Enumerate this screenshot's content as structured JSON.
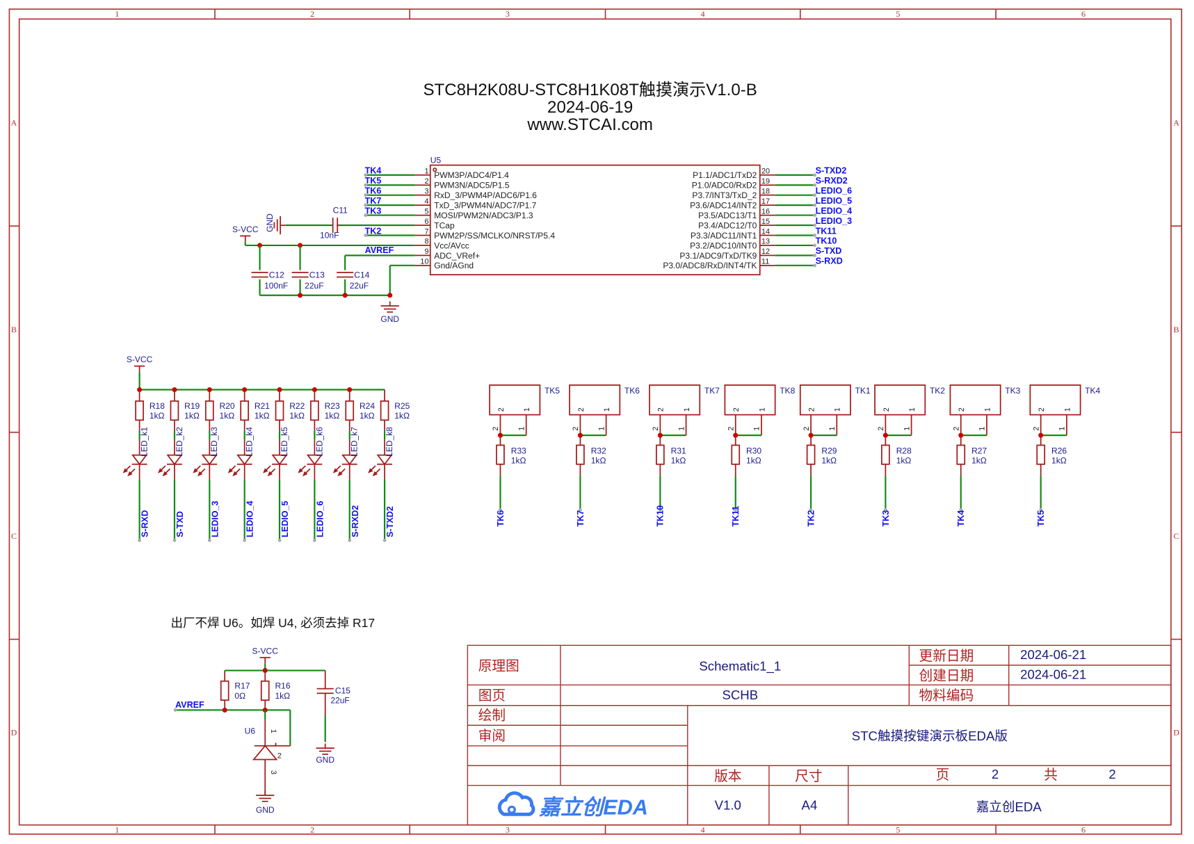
{
  "title": {
    "line1": "STC8H2K08U-STC8H1K08T触摸演示V1.0-B",
    "line2": "2024-06-19",
    "line3": "www.STCAI.com"
  },
  "border": {
    "columns": [
      "1",
      "2",
      "3",
      "4",
      "5",
      "6"
    ],
    "rows": [
      "A",
      "B",
      "C",
      "D"
    ]
  },
  "colors": {
    "wire": "#138a13",
    "component": "#a51c1c",
    "junction": "#cc0000",
    "net_label": "#1010ee",
    "designator": "#1c1c8c",
    "frame": "#b03030"
  },
  "u5": {
    "designator": "U5",
    "left_pins": [
      {
        "num": "1",
        "name": "PWM3P/ADC4/P1.4",
        "net": "TK4"
      },
      {
        "num": "2",
        "name": "PWM3N/ADC5/P1.5",
        "net": "TK5"
      },
      {
        "num": "3",
        "name": "RxD_3/PWM4P/ADC6/P1.6",
        "net": "TK6"
      },
      {
        "num": "4",
        "name": "TxD_3/PWM4N/ADC7/P1.7",
        "net": "TK7"
      },
      {
        "num": "5",
        "name": "MOSI/PWM2N/ADC3/P1.3",
        "net": "TK3"
      },
      {
        "num": "6",
        "name": "TCap",
        "net": ""
      },
      {
        "num": "7",
        "name": "PWM2P/SS/MCLKO/NRST/P5.4",
        "net": "TK2"
      },
      {
        "num": "8",
        "name": "Vcc/AVcc",
        "net": ""
      },
      {
        "num": "9",
        "name": "ADC_VRef+",
        "net": "AVREF"
      },
      {
        "num": "10",
        "name": "Gnd/AGnd",
        "net": ""
      }
    ],
    "right_pins": [
      {
        "num": "20",
        "name": "P1.1/ADC1/TxD2",
        "net": "S-TXD2"
      },
      {
        "num": "19",
        "name": "P1.0/ADC0/RxD2",
        "net": "S-RXD2"
      },
      {
        "num": "18",
        "name": "P3.7/INT3/TxD_2",
        "net": "LEDIO_6"
      },
      {
        "num": "17",
        "name": "P3.6/ADC14/INT2",
        "net": "LEDIO_5"
      },
      {
        "num": "16",
        "name": "P3.5/ADC13/T1",
        "net": "LEDIO_4"
      },
      {
        "num": "15",
        "name": "P3.4/ADC12/T0",
        "net": "LEDIO_3"
      },
      {
        "num": "14",
        "name": "P3.3/ADC11/INT1",
        "net": "TK11"
      },
      {
        "num": "13",
        "name": "P3.2/ADC10/INT0",
        "net": "TK10"
      },
      {
        "num": "12",
        "name": "P3.1/ADC9/TxD/TK9",
        "net": "S-TXD"
      },
      {
        "num": "11",
        "name": "P3.0/ADC8/RxD/INT4/TK",
        "net": "S-RXD"
      }
    ]
  },
  "power": {
    "svcc": "S-VCC",
    "gnd": "GND"
  },
  "caps": {
    "c11": {
      "ref": "C11",
      "value": "10nF"
    },
    "c12": {
      "ref": "C12",
      "value": "100nF"
    },
    "c13": {
      "ref": "C13",
      "value": "22uF"
    },
    "c14": {
      "ref": "C14",
      "value": "22uF"
    },
    "c15": {
      "ref": "C15",
      "value": "22uF"
    }
  },
  "leds": [
    {
      "ref": "R18",
      "value": "1kΩ",
      "mid_net": "LED_k1",
      "net": "S-RXD"
    },
    {
      "ref": "R19",
      "value": "1kΩ",
      "mid_net": "LED_k2",
      "net": "S-TXD"
    },
    {
      "ref": "R20",
      "value": "1kΩ",
      "mid_net": "LED_k3",
      "net": "LEDIO_3"
    },
    {
      "ref": "R21",
      "value": "1kΩ",
      "mid_net": "LED_k4",
      "net": "LEDIO_4"
    },
    {
      "ref": "R22",
      "value": "1kΩ",
      "mid_net": "LED_k5",
      "net": "LEDIO_5"
    },
    {
      "ref": "R23",
      "value": "1kΩ",
      "mid_net": "LED_k6",
      "net": "LEDIO_6"
    },
    {
      "ref": "R24",
      "value": "1kΩ",
      "mid_net": "LED_k7",
      "net": "S-RXD2"
    },
    {
      "ref": "R25",
      "value": "1kΩ",
      "mid_net": "LED_k8",
      "net": "S-TXD2"
    }
  ],
  "touch_pads": [
    {
      "ref": "TK5",
      "res": "R33",
      "value": "1kΩ",
      "net": "TK6"
    },
    {
      "ref": "TK6",
      "res": "R32",
      "value": "1kΩ",
      "net": "TK7"
    },
    {
      "ref": "TK7",
      "res": "R31",
      "value": "1kΩ",
      "net": "TK10"
    },
    {
      "ref": "TK8",
      "res": "R30",
      "value": "1kΩ",
      "net": "TK11"
    },
    {
      "ref": "TK1",
      "res": "R29",
      "value": "1kΩ",
      "net": "TK2"
    },
    {
      "ref": "TK2",
      "res": "R28",
      "value": "1kΩ",
      "net": "TK3"
    },
    {
      "ref": "TK3",
      "res": "R27",
      "value": "1kΩ",
      "net": "TK4"
    },
    {
      "ref": "TK4",
      "res": "R26",
      "value": "1kΩ",
      "net": "TK5"
    }
  ],
  "pad_pins": {
    "p1": "1",
    "p2": "2"
  },
  "note": "出厂不焊 U6。如焊 U4, 必须去掉 R17",
  "vref": {
    "r17": {
      "ref": "R17",
      "value": "0Ω"
    },
    "r16": {
      "ref": "R16",
      "value": "1kΩ"
    },
    "u6": {
      "ref": "U6",
      "pin1": "1",
      "pin2": "2",
      "pin3": "3"
    },
    "net": "AVREF"
  },
  "title_block": {
    "schematic_label": "原理图",
    "schematic_value": "Schematic1_1",
    "page_label": "图页",
    "page_value": "SCHB",
    "updated_label": "更新日期",
    "updated_value": "2024-06-21",
    "created_label": "创建日期",
    "created_value": "2024-06-21",
    "part_label": "物料编码",
    "part_value": "",
    "drawn_label": "绘制",
    "review_label": "审阅",
    "board_title": "STC触摸按键演示板EDA版",
    "version_label": "版本",
    "version_value": "V1.0",
    "size_label": "尺寸",
    "size_value": "A4",
    "sheet_label": "页",
    "sheet_value": "2",
    "total_label": "共",
    "total_value": "2",
    "company": "嘉立创EDA",
    "logo_text": "嘉立创EDA"
  }
}
